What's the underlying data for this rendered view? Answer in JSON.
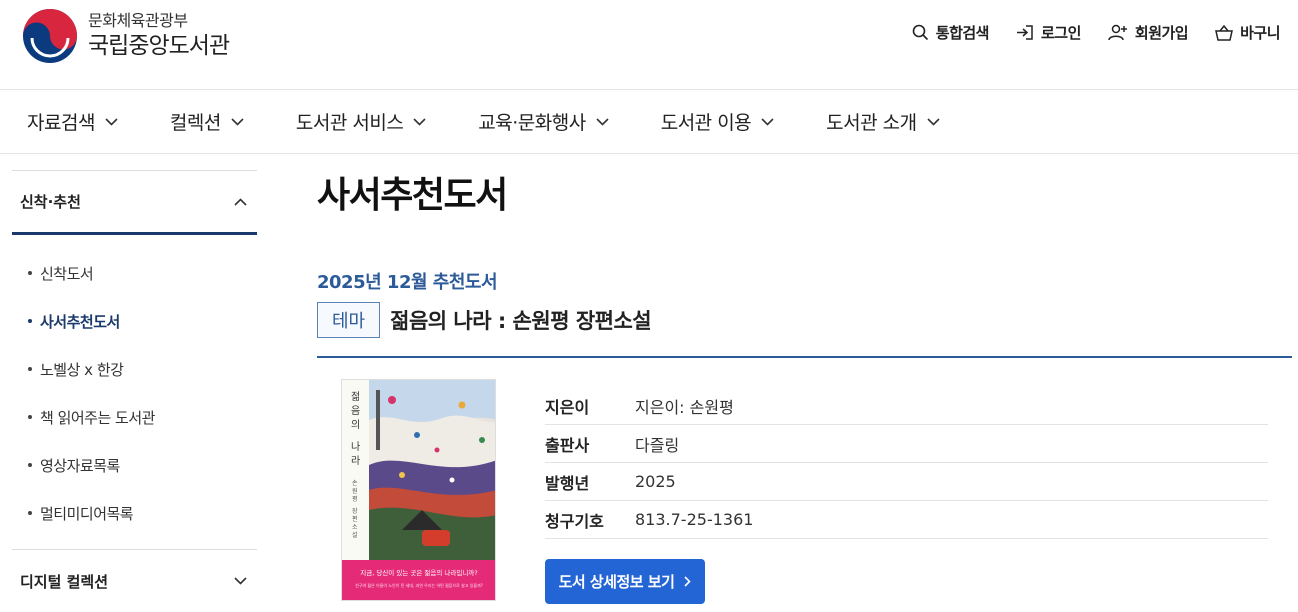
{
  "header": {
    "ministry": "문화체육관광부",
    "library": "국립중앙도서관",
    "util": [
      {
        "label": "통합검색",
        "icon": "search-icon"
      },
      {
        "label": "로그인",
        "icon": "login-icon"
      },
      {
        "label": "회원가입",
        "icon": "user-add-icon"
      },
      {
        "label": "바구니",
        "icon": "basket-icon"
      }
    ]
  },
  "gnb": [
    "자료검색",
    "컬렉션",
    "도서관 서비스",
    "교육·문화행사",
    "도서관 이용",
    "도서관 소개"
  ],
  "lnb": {
    "section": "신착·추천",
    "items": [
      "신착도서",
      "사서추천도서",
      "노벨상 x 한강",
      "책 읽어주는 도서관",
      "영상자료목록",
      "멀티미디어목록"
    ],
    "next_section": "디지털 컬렉션"
  },
  "main": {
    "title": "사서추천도서",
    "month": "2025년 12월 추천도서",
    "theme_badge": "테마",
    "book_title": "젊음의 나라 : 손원평 장편소설",
    "cover": {
      "title": "젊음의 나라",
      "author": "손원평 장편소설",
      "band_text": "지금, 당신이 있는 곳은 젊음의 나라입니까?",
      "band_sub": "친구여 젊은 이들이 노인이 된 세대, 과연 우리는 어떤 젊음으로 살고 있을까?"
    },
    "info": [
      {
        "label": "지은이",
        "value": "지은이: 손원평"
      },
      {
        "label": "출판사",
        "value": "다즐링"
      },
      {
        "label": "발행년",
        "value": "2025"
      },
      {
        "label": "청구기호",
        "value": "813.7-25-1361"
      }
    ],
    "detail_button": "도서 상세정보 보기"
  },
  "colors": {
    "accent": "#2d5b9a",
    "button": "#2465d6",
    "active": "#1a3a6b",
    "cover_band": "#e52b78"
  }
}
